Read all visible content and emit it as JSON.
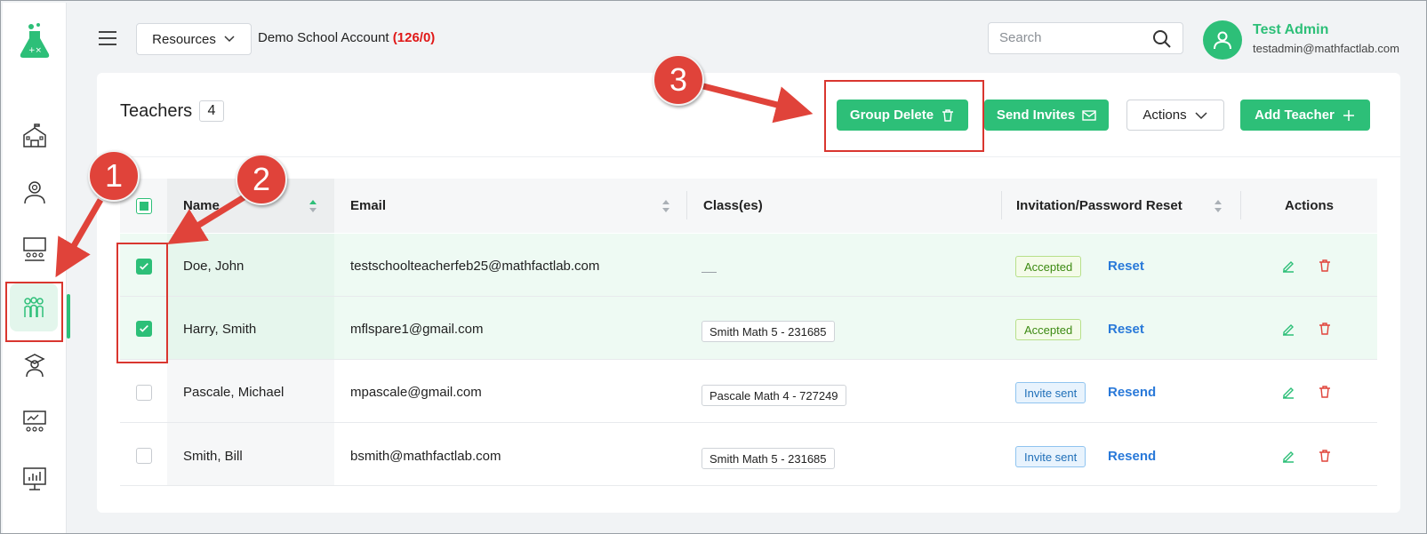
{
  "topbar": {
    "resources_label": "Resources",
    "account_name": "Demo School Account",
    "account_count": "(126/0)",
    "search_placeholder": "Search"
  },
  "user": {
    "name": "Test Admin",
    "email": "testadmin@mathfactlab.com"
  },
  "page": {
    "title": "Teachers",
    "count": "4"
  },
  "toolbar": {
    "group_delete": "Group Delete",
    "send_invites": "Send Invites",
    "actions": "Actions",
    "add_teacher": "Add Teacher"
  },
  "table": {
    "headers": {
      "name": "Name",
      "email": "Email",
      "classes": "Class(es)",
      "invitation": "Invitation/Password Reset",
      "actions": "Actions"
    },
    "rows": [
      {
        "name": "Doe, John",
        "email": "testschoolteacherfeb25@mathfactlab.com",
        "class": "",
        "status": "Accepted",
        "link": "Reset",
        "checked": true
      },
      {
        "name": "Harry, Smith",
        "email": "mflspare1@gmail.com",
        "class": "Smith Math 5 - 231685",
        "status": "Accepted",
        "link": "Reset",
        "checked": true
      },
      {
        "name": "Pascale, Michael",
        "email": "mpascale@gmail.com",
        "class": "Pascale Math 4 - 727249",
        "status": "Invite sent",
        "link": "Resend",
        "checked": false
      },
      {
        "name": "Smith, Bill",
        "email": "bsmith@mathfactlab.com",
        "class": "Smith Math 5 - 231685",
        "status": "Invite sent",
        "link": "Resend",
        "checked": false
      }
    ]
  },
  "annotations": {
    "callout_1": "1",
    "callout_2": "2",
    "callout_3": "3"
  },
  "colors": {
    "brand_green": "#2dbf78",
    "annotation_red": "#e0433a",
    "link_blue": "#2979d9",
    "count_red": "#e01818"
  }
}
